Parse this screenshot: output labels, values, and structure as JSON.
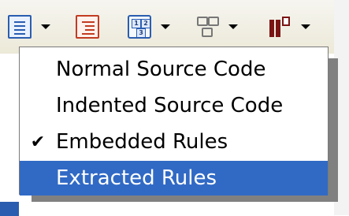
{
  "toolbar": {
    "buttons": [
      {
        "icon": "source-view-icon",
        "has_dropdown": true
      },
      {
        "icon": "indented-source-icon",
        "has_dropdown": false
      },
      {
        "icon": "code-layout-icon",
        "has_dropdown": true
      },
      {
        "icon": "diagram-icon",
        "has_dropdown": true
      },
      {
        "icon": "ui-designer-icon",
        "has_dropdown": true
      }
    ]
  },
  "menu": {
    "items": [
      {
        "label": "Normal Source Code",
        "checked": false,
        "highlighted": false
      },
      {
        "label": "Indented Source Code",
        "checked": false,
        "highlighted": false
      },
      {
        "label": "Embedded Rules",
        "checked": true,
        "highlighted": false
      },
      {
        "label": "Extracted Rules",
        "checked": false,
        "highlighted": true
      }
    ],
    "check_mark": "✔"
  },
  "colors": {
    "highlight": "#316ac5",
    "toolbar_bg": "#ece9d8"
  }
}
